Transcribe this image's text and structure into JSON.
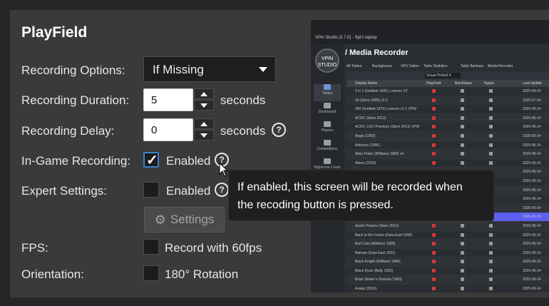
{
  "form": {
    "title": "PlayField",
    "recording_options": {
      "label": "Recording Options:",
      "value": "If Missing"
    },
    "recording_duration": {
      "label": "Recording Duration:",
      "value": "5",
      "unit": "seconds"
    },
    "recording_delay": {
      "label": "Recording Delay:",
      "value": "0",
      "unit": "seconds"
    },
    "in_game_recording": {
      "label": "In-Game Recording:",
      "checkbox_label": "Enabled",
      "checked": true
    },
    "expert_settings": {
      "label": "Expert Settings:",
      "checkbox_label": "Enabled",
      "checked": false,
      "button_label": "Settings"
    },
    "fps": {
      "label": "FPS:",
      "checkbox_label": "Record with 60fps",
      "checked": false
    },
    "orientation": {
      "label": "Orientation:",
      "checkbox_label": "180° Rotation",
      "checked": false
    }
  },
  "tooltip": {
    "line1": "If enabled, this screen will be recorded when",
    "line2": "the recoding button is pressed."
  },
  "help_glyph": "?",
  "preview": {
    "window_title": "VPin Studio (3.7.0) - Spi's laptop",
    "logo_top": "VPIN",
    "logo_bottom": "STUDIO",
    "heading": "/ Media Recorder",
    "nav": [
      {
        "label": "Tables",
        "active": true
      },
      {
        "label": "Dashboard",
        "active": false
      },
      {
        "label": "Players",
        "active": false
      },
      {
        "label": "Competitions",
        "active": false
      },
      {
        "label": "Highscore Cards",
        "active": false
      }
    ],
    "tabs": [
      "All Tables",
      "Backglasses",
      "VPS Tables",
      "Table Statistics",
      "Table Backups",
      "Media Recorder"
    ],
    "filter_value": "Visual Pinball X",
    "columns": [
      "Display Name",
      "PlayField",
      "BackGlass",
      "Topper",
      "Last Update"
    ],
    "rows": [
      {
        "name": "2 in 1 (Gottlieb 1981) Lorenzo V2",
        "date": "2025-09-20"
      },
      {
        "name": "24 (Stern 2009) v2.2",
        "date": "2025-07-14"
      },
      {
        "name": "300 (Gottlieb 1975) Lorenzo v1.1 VPW",
        "date": "2025-06-14"
      },
      {
        "name": "ACDC (Stern 2012)",
        "date": "2025-06-14"
      },
      {
        "name": "ACDC LUCI Premium (Stern 2013) VPW",
        "date": "2025-06-14"
      },
      {
        "name": "Aegis (1992)",
        "date": "2025-06-14"
      },
      {
        "name": "Airborne (1996)",
        "date": "2025-06-14"
      },
      {
        "name": "Alien Poker (Williams 1980) v4",
        "date": "2025-06-14"
      },
      {
        "name": "Aliens (2020)",
        "date": "2025-06-14"
      },
      {
        "name": "Amazon Hunt (Gottlieb 1983)",
        "date": "2025-06-14"
      },
      {
        "name": "America's Most Haunted (Spooky 2014)",
        "date": "2025-06-14"
      },
      {
        "name": "Apollo 13 (Sega 1995)",
        "date": "2025-06-14"
      },
      {
        "name": "Arena (Gottlieb 1987)",
        "date": "2025-06-14"
      },
      {
        "name": "Atlantis (Bally 1989)",
        "date": "2025-06-14"
      },
      {
        "name": "Attack from Mars (Bally 1995)",
        "date": "2025-05-16",
        "selected": true
      },
      {
        "name": "Austin Powers (Stern 2001)",
        "date": "2025-06-14"
      },
      {
        "name": "Back to the Future (Data East 1990)",
        "date": "2025-06-14"
      },
      {
        "name": "Bad Cats (Williams 1989)",
        "date": "2025-06-14"
      },
      {
        "name": "Batman (Data East 1991)",
        "date": "2025-06-14"
      },
      {
        "name": "Black Knight (Williams 1980)",
        "date": "2025-06-14"
      },
      {
        "name": "Black Rose (Bally 1992)",
        "date": "2025-06-14"
      },
      {
        "name": "Bram Stoker's Dracula (1993)",
        "date": "2025-06-14"
      },
      {
        "name": "Avatar (2010)",
        "date": "2025-06-14"
      },
      {
        "name": "Avatar (2010) (Stern) v2.0.1",
        "date": "2025-06-14"
      },
      {
        "name": "Avengers",
        "date": "2025-06-14"
      },
      {
        "name": "Avengers LE (Stern 2012) v2.0.1",
        "date": "2025-06-14"
      }
    ]
  }
}
